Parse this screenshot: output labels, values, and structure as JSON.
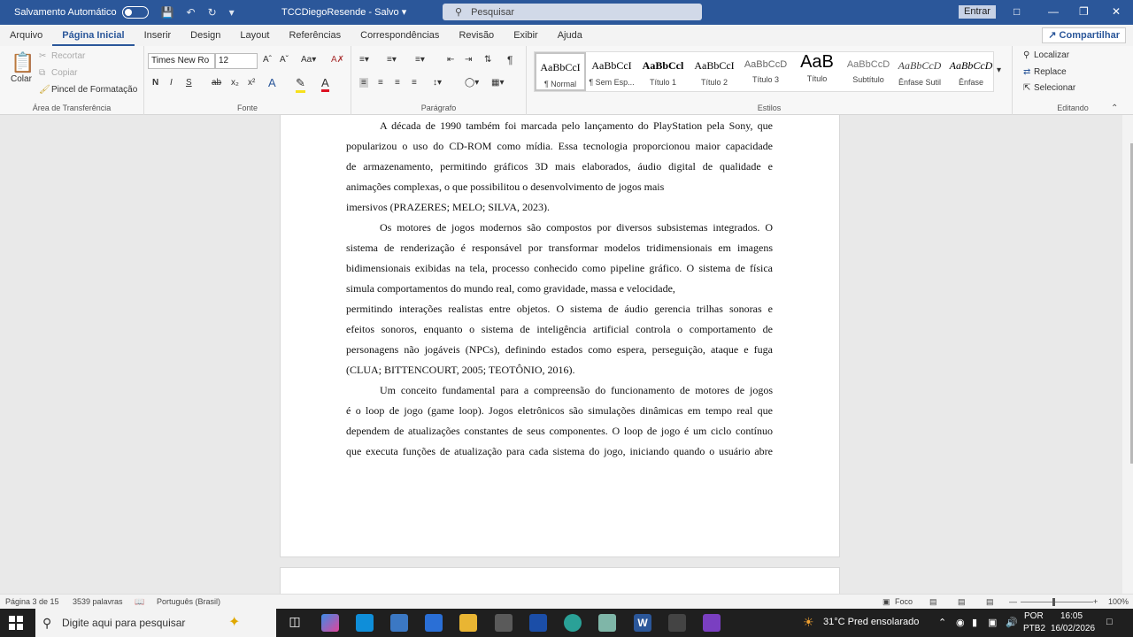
{
  "titlebar": {
    "autosave": "Salvamento Automático",
    "doc_title": "TCCDiegoResende  -  Salvo  ▾",
    "search": "Pesquisar",
    "signin": "Entrar"
  },
  "tabs": [
    "Arquivo",
    "Página Inicial",
    "Inserir",
    "Design",
    "Layout",
    "Referências",
    "Correspondências",
    "Revisão",
    "Exibir",
    "Ajuda"
  ],
  "share": "Compartilhar",
  "clipboard": {
    "paste": "Colar",
    "cut": "Recortar",
    "copy": "Copiar",
    "format_painter": "Pincel de Formatação",
    "label": "Área de Transferência"
  },
  "font": {
    "name": "Times New Ro",
    "size": "12",
    "bold": "N",
    "italic": "I",
    "underline": "S",
    "strike": "ab",
    "label": "Fonte"
  },
  "paragraph": {
    "label": "Parágrafo"
  },
  "styles": {
    "label": "Estilos",
    "items": [
      {
        "preview": "AaBbCcI",
        "name": "¶ Normal"
      },
      {
        "preview": "AaBbCcI",
        "name": "¶ Sem Esp..."
      },
      {
        "preview": "AaBbCcl",
        "name": "Título 1"
      },
      {
        "preview": "AaBbCcI",
        "name": "Título 2"
      },
      {
        "preview": "AaBbCcD",
        "name": "Título 3"
      },
      {
        "preview": "AaB",
        "name": "Título"
      },
      {
        "preview": "AaBbCcD",
        "name": "Subtítulo"
      },
      {
        "preview": "AaBbCcD",
        "name": "Ênfase Sutil"
      },
      {
        "preview": "AaBbCcD",
        "name": "Ênfase"
      }
    ]
  },
  "editing": {
    "find": "Localizar",
    "replace": "Replace",
    "select": "Selecionar",
    "label": "Editando"
  },
  "document": {
    "lines": [
      "A década de 1990 também foi marcada pelo lançamento do PlayStation pela Sony, que",
      "popularizou o uso do CD-ROM como mídia. Essa tecnologia proporcionou maior capacidade",
      "de armazenamento, permitindo gráficos 3D mais elaborados, áudio digital de qualidade e",
      "animações complexas, o que possibilitou o desenvolvimento de jogos mais",
      "imersivos (PRAZERES; MELO; SILVA, 2023).",
      "Os motores de jogos modernos são compostos por diversos subsistemas integrados. O",
      "sistema de renderização é responsável por transformar modelos tridimensionais em imagens",
      "bidimensionais exibidas na tela, processo conhecido como pipeline gráfico. O sistema de física",
      "simula comportamentos do mundo real, como gravidade, massa e velocidade,",
      "permitindo interações realistas entre objetos. O sistema de áudio gerencia trilhas sonoras e",
      "efeitos sonoros, enquanto o sistema de inteligência artificial controla o comportamento de",
      "personagens não jogáveis (NPCs), definindo estados como espera, perseguição, ataque e fuga",
      "(CLUA; BITTENCOURT, 2005; TEOTÔNIO, 2016).",
      "Um conceito fundamental para a compreensão do funcionamento de motores de jogos",
      "é o loop de jogo (game loop). Jogos eletrônicos são simulações dinâmicas em tempo real que",
      "dependem de atualizações constantes de seus componentes. O loop de jogo é um ciclo contínuo",
      "que executa funções de atualização para cada sistema do jogo, iniciando quando o usuário abre"
    ]
  },
  "status": {
    "page": "Página 3 de 15",
    "words": "3539 palavras",
    "language": "Português (Brasil)",
    "focus": "Foco",
    "zoom": "100%"
  },
  "taskbar": {
    "search": "Digite aqui para pesquisar",
    "weather": "31°C  Pred ensolarado",
    "lang1": "POR",
    "lang2": "PTB2",
    "time": "16:05",
    "date": "16/02/2026"
  }
}
